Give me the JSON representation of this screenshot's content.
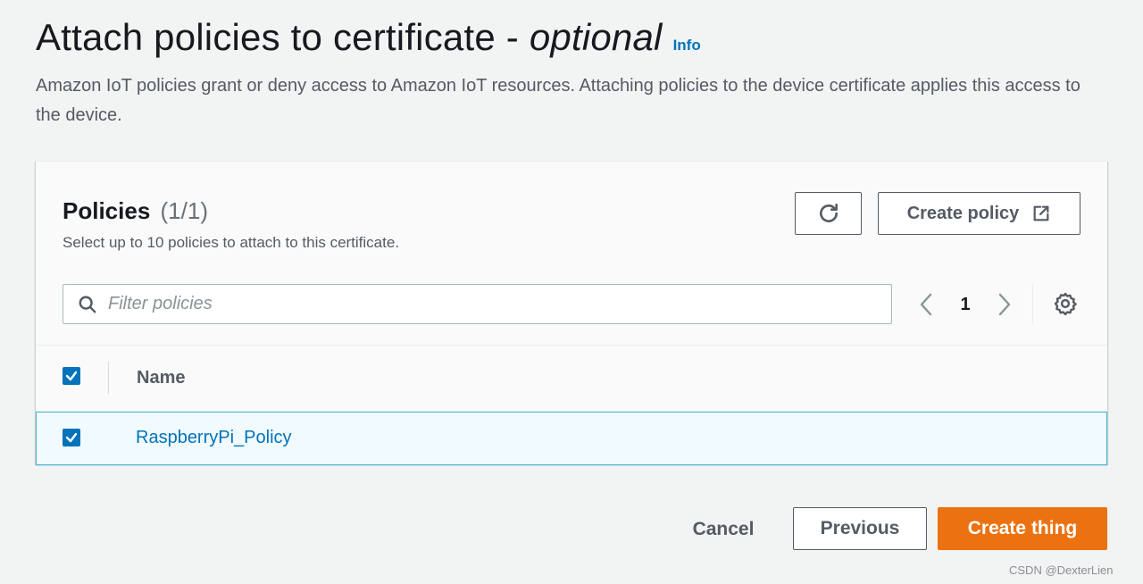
{
  "header": {
    "title_main": "Attach policies to certificate - ",
    "title_optional": "optional",
    "info_link": "Info",
    "description": "Amazon IoT policies grant or deny access to Amazon IoT resources. Attaching policies to the device certificate applies this access to the device."
  },
  "policies": {
    "heading": "Policies",
    "count": "(1/1)",
    "subtitle": "Select up to 10 policies to attach to this certificate.",
    "refresh_icon": "refresh-icon",
    "create_policy_label": "Create policy",
    "create_policy_icon": "external-link-icon",
    "filter_placeholder": "Filter policies",
    "filter_value": "",
    "pagination": {
      "current_page": "1",
      "prev_icon": "chevron-left-icon",
      "next_icon": "chevron-right-icon"
    },
    "settings_icon": "gear-icon"
  },
  "table": {
    "columns": [
      "Name"
    ],
    "header_checked": true,
    "rows": [
      {
        "name": "RaspberryPi_Policy",
        "checked": true
      }
    ]
  },
  "footer": {
    "cancel_label": "Cancel",
    "previous_label": "Previous",
    "create_thing_label": "Create thing"
  },
  "watermark": "CSDN @DexterLien",
  "colors": {
    "background": "#f2f3f3",
    "link": "#0073bb",
    "primary_button": "#ec7211",
    "selected_row_bg": "#f1faff",
    "selected_row_border": "#44b9d6",
    "checkbox": "#0073bb"
  }
}
